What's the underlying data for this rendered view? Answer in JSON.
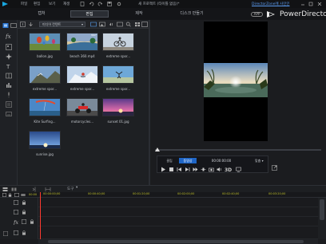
{
  "titlebar": {
    "menus": [
      "파일",
      "편집",
      "보기",
      "재생"
    ],
    "window_title": "새 프로젝트 (타이틀 없음)*",
    "directorzone_link": "DirectorZone에 사인인",
    "icons": [
      "app-logo-icon",
      "undo-icon",
      "redo-icon",
      "save-icon",
      "settings-icon",
      "minimize-icon",
      "maximize-icon",
      "close-icon"
    ]
  },
  "mode_tabs": [
    {
      "label": "캡처",
      "active": false
    },
    {
      "label": "편집",
      "active": true
    },
    {
      "label": "제작",
      "active": false
    },
    {
      "label": "디스크 만들기",
      "active": false
    }
  ],
  "app_badge": "APP",
  "brand": "PowerDirector",
  "media": {
    "library_dropdown": "미디어 컨텐트",
    "clips": [
      {
        "name": "ballon.jpg",
        "kind": "balloon"
      },
      {
        "name": "beach 360.mp4",
        "kind": "beach"
      },
      {
        "name": "extreme spor...",
        "kind": "bmx"
      },
      {
        "name": "extreme spor...",
        "kind": "mountain"
      },
      {
        "name": "extreme spor...",
        "kind": "snow"
      },
      {
        "name": "extreme spor...",
        "kind": "skydive"
      },
      {
        "name": "Kite Surfing...",
        "kind": "kite"
      },
      {
        "name": "motorcycles...",
        "kind": "moto"
      },
      {
        "name": "sunset 01.jpg",
        "kind": "sunset"
      },
      {
        "name": "sunrise.jpg",
        "kind": "sunrise"
      }
    ]
  },
  "preview": {
    "mode_clip": "클립",
    "mode_movie": "동영상",
    "timecode": "00:00:00:00",
    "fit_label": "맞춤"
  },
  "timeline": {
    "tool_label": "도구",
    "ruler_labels": [
      "00:00",
      "00:00:00;00",
      "00:00:40;00",
      "00:01:20;00",
      "00:02:00;00",
      "00:02:40;00",
      "00:03:20;00"
    ]
  },
  "colors": {
    "accent_blue": "#1f66c7",
    "playhead_red": "#ff3b30",
    "ruler_yellow": "#c2c22a"
  }
}
